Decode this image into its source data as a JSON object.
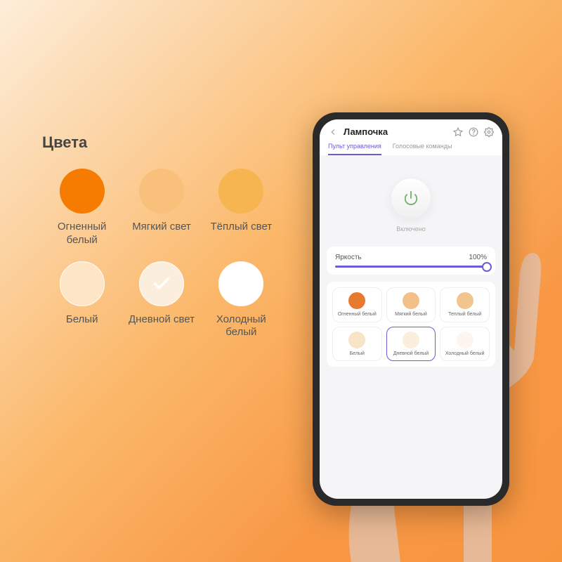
{
  "panel": {
    "title": "Цвета",
    "swatches": [
      {
        "label": "Огненный\nбелый",
        "color": "#f57c00",
        "bordered": false,
        "check": false
      },
      {
        "label": "Мягкий свет",
        "color": "#f8c07a",
        "bordered": false,
        "check": false
      },
      {
        "label": "Тёплый свет",
        "color": "#f7b552",
        "bordered": false,
        "check": false
      },
      {
        "label": "Белый",
        "color": "#fde5c6",
        "bordered": true,
        "check": false
      },
      {
        "label": "Дневной свет",
        "color": "#fbeedd",
        "bordered": true,
        "check": true
      },
      {
        "label": "Холодный\nбелый",
        "color": "#ffffff",
        "bordered": true,
        "check": false
      }
    ]
  },
  "phone": {
    "title": "Лампочка",
    "tabs": [
      {
        "label": "Пульт управления",
        "active": true
      },
      {
        "label": "Голосовые команды",
        "active": false
      }
    ],
    "status": "Включено",
    "brightness": {
      "label": "Яркость",
      "value": "100%"
    },
    "colors": [
      {
        "label": "Огненный белый",
        "color": "#e77a2e",
        "selected": false
      },
      {
        "label": "Мягкий белый",
        "color": "#f2c18a",
        "selected": false
      },
      {
        "label": "Теплый белый",
        "color": "#f2c58f",
        "selected": false
      },
      {
        "label": "Белый",
        "color": "#f7e4c9",
        "selected": false
      },
      {
        "label": "Дневной белый",
        "color": "#fbeedd",
        "selected": true
      },
      {
        "label": "Холодный белый",
        "color": "#fdf5ee",
        "selected": false
      }
    ]
  }
}
